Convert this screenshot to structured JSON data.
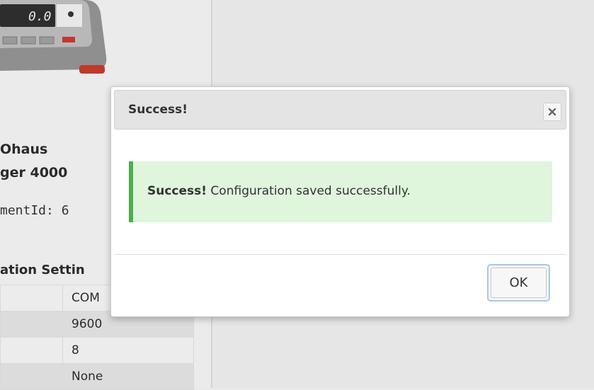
{
  "background": {
    "device_display": "0.0",
    "manufacturer": "Ohaus",
    "model": "ger 4000",
    "instrument_id": "mentId: 6",
    "settings_heading": "ation Settin",
    "settings_rows": [
      {
        "key": "",
        "value": "COM"
      },
      {
        "key": "",
        "value": "9600"
      },
      {
        "key": "",
        "value": "8"
      },
      {
        "key": "",
        "value": "None"
      }
    ]
  },
  "modal": {
    "title": "Success!",
    "close_icon": "close-icon",
    "alert": {
      "strong": "Success!",
      "message": " Configuration saved successfully.",
      "color": "#4cae4c",
      "background": "#dff5dc"
    },
    "ok_label": "OK"
  }
}
